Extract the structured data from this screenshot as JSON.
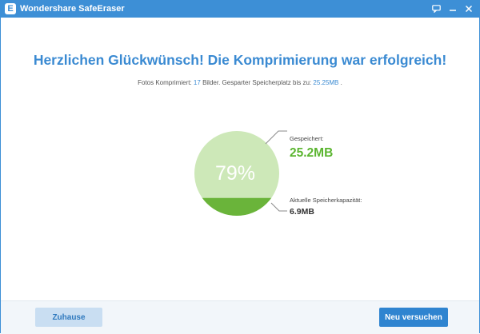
{
  "window": {
    "app_title": "Wondershare SafeEraser",
    "logo_letter": "E"
  },
  "main": {
    "heading": "Herzlichen Glückwünsch! Die Komprimierung war erfolgreich!",
    "subline_prefix": "Fotos Komprimiert:",
    "photo_count": "17",
    "subline_middle": "Bilder. Gesparter Speicherplatz bis zu:",
    "saved_amount": "25.25MB",
    "subline_suffix": "."
  },
  "result": {
    "percent_label": "79%",
    "percent_value": 0.79,
    "saved_label": "Gespeichert:",
    "saved_value": "25.2MB",
    "current_label": "Aktuelle Speicherkapazität:",
    "current_value": "6.9MB"
  },
  "footer": {
    "home_label": "Zuhause",
    "retry_label": "Neu versuchen"
  },
  "colors": {
    "accent_blue": "#3d8fd6",
    "pie_saved": "#cde8b8",
    "pie_remaining": "#6ab43a",
    "saved_text": "#5bb530"
  },
  "icons": [
    "app-logo-icon",
    "chat-icon",
    "minimize-icon",
    "close-icon"
  ]
}
